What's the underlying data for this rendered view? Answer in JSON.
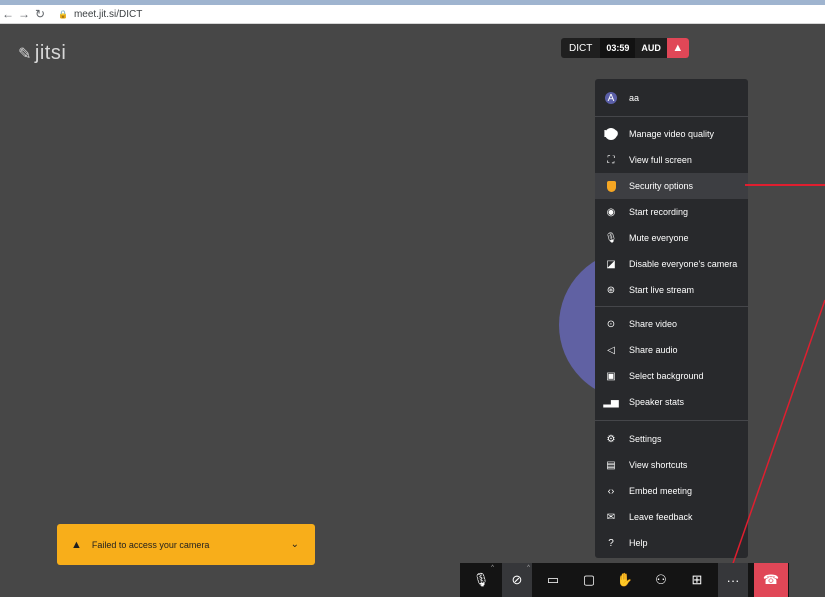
{
  "browser": {
    "url": "meet.jit.si/DICT"
  },
  "app": {
    "logo": "jitsi"
  },
  "recording_bar": {
    "name": "DICT",
    "time": "03:59",
    "aud": "AUD"
  },
  "menu": {
    "user": "aa",
    "user_initial": "A",
    "items": [
      {
        "label": "Manage video quality",
        "icon": "hd-icon"
      },
      {
        "label": "View full screen",
        "icon": "fullscreen-icon"
      },
      {
        "label": "Security options",
        "icon": "shield-icon",
        "highlighted": true
      },
      {
        "label": "Start recording",
        "icon": "record-icon"
      },
      {
        "label": "Mute everyone",
        "icon": "mute-everyone-icon"
      },
      {
        "label": "Disable everyone's camera",
        "icon": "camera-off-icon"
      },
      {
        "label": "Start live stream",
        "icon": "live-stream-icon"
      },
      {
        "label": "Share video",
        "icon": "play-circle-icon"
      },
      {
        "label": "Share audio",
        "icon": "speaker-icon"
      },
      {
        "label": "Select background",
        "icon": "image-icon"
      },
      {
        "label": "Speaker stats",
        "icon": "bar-chart-icon"
      },
      {
        "label": "Settings",
        "icon": "gear-icon"
      },
      {
        "label": "View shortcuts",
        "icon": "document-icon"
      },
      {
        "label": "Embed meeting",
        "icon": "code-icon"
      },
      {
        "label": "Leave feedback",
        "icon": "feedback-icon"
      },
      {
        "label": "Help",
        "icon": "help-icon"
      }
    ]
  },
  "toast": {
    "message": "Failed to access your camera"
  },
  "toolbar": {
    "buttons": [
      "microphone-muted-icon",
      "camera-off-icon",
      "screen-share-icon",
      "chat-icon",
      "raise-hand-icon",
      "participants-icon",
      "tile-view-icon",
      "more-icon",
      "hangup-icon"
    ]
  },
  "colors": {
    "hangup": "#e04757",
    "toast": "#f8ae1a",
    "annotation": "#e01e2f",
    "avatar": "#6061a3"
  }
}
